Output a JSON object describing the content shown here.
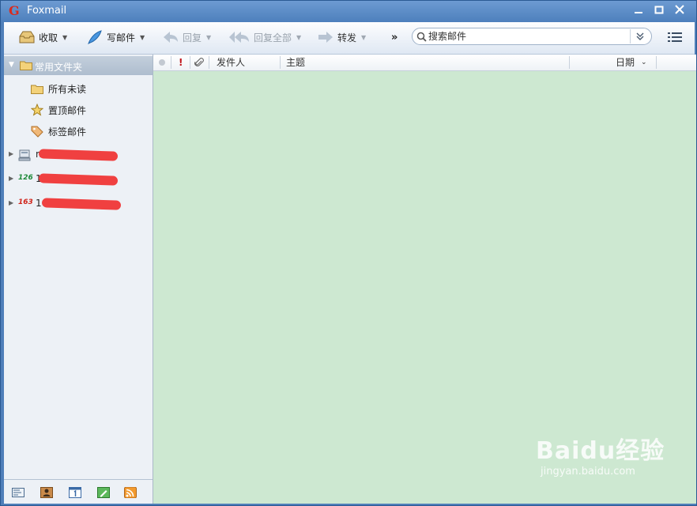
{
  "window": {
    "title": "Foxmail",
    "logo_letter": "G",
    "controls": [
      "minimize",
      "maximize",
      "close"
    ]
  },
  "toolbar": {
    "receive_label": "收取",
    "compose_label": "写邮件",
    "reply_label": "回复",
    "reply_all_label": "回复全部",
    "forward_label": "转发",
    "more_label": "»",
    "search_placeholder": "搜索邮件"
  },
  "sidebar": {
    "header_label": "常用文件夹",
    "folders": [
      {
        "label": "所有未读",
        "icon": "folder-icon"
      },
      {
        "label": "置顶邮件",
        "icon": "star-icon"
      },
      {
        "label": "标签邮件",
        "icon": "tag-icon"
      }
    ],
    "accounts": [
      {
        "badge": "",
        "icon": "server-icon",
        "label": "no"
      },
      {
        "badge": "126",
        "label": "126"
      },
      {
        "badge": "163",
        "label": "163"
      }
    ],
    "bottom_icons": [
      "mail-icon",
      "contacts-icon",
      "calendar-icon",
      "notes-icon",
      "rss-icon"
    ]
  },
  "message_list": {
    "columns": {
      "sender": "发件人",
      "subject": "主题",
      "date": "日期"
    },
    "flag_symbol": "!"
  },
  "watermark": {
    "brand": "Baidu经验",
    "url": "jingyan.baidu.com"
  },
  "colors": {
    "titlebar": "#5a89c4",
    "list_background": "#cde8d1",
    "sidebar_background": "#edf1f6"
  }
}
